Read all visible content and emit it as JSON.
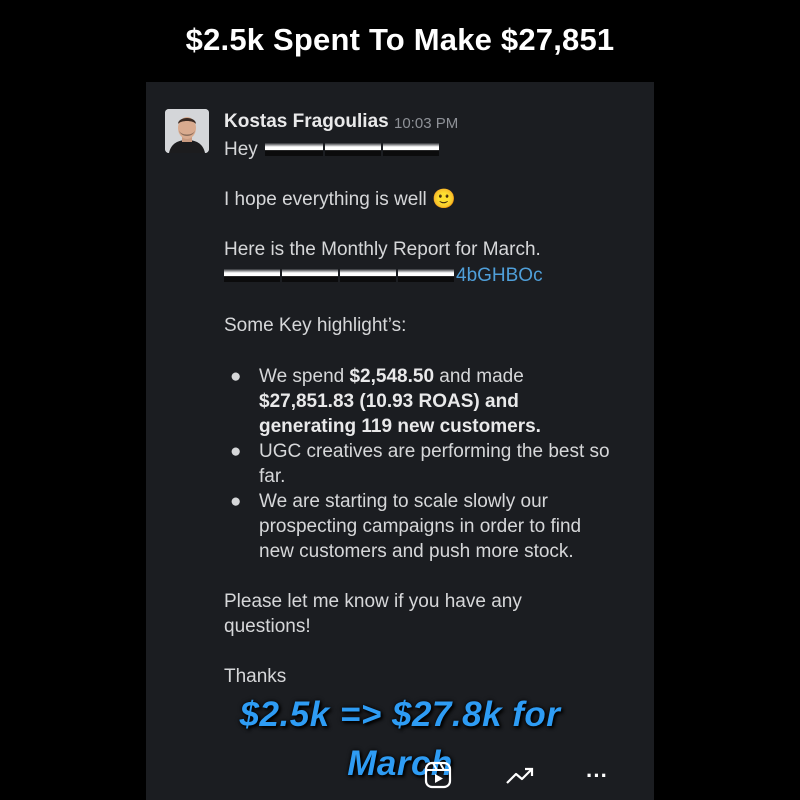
{
  "headline": "$2.5k Spent To Make $27,851",
  "message": {
    "sender": "Kostas Fragoulias",
    "time": "10:03 PM",
    "greeting": "Hey",
    "line1": "I hope everything is well 🙂",
    "line2": "Here is the Monthly Report for March.",
    "link_tail": "4bGHBOc",
    "highlights_title": "Some Key highlight’s:",
    "bullets": [
      {
        "a": "We spend ",
        "b": "$2,548.50",
        "c": " and made",
        "d": "$27,851.83 (10.93 ROAS) and generating 119 new customers."
      },
      {
        "text": "UGC creatives are performing the best so far."
      },
      {
        "text": "We are starting to scale slowly our prospecting campaigns in order to find new customers and push more stock."
      }
    ],
    "closing": "Please let me know if you have any questions!",
    "thanks": "Thanks"
  },
  "overlay": {
    "line1": "$2.5k => $27.8k for",
    "line2": "March"
  },
  "controls": {
    "reel_icon": "reels-icon",
    "trend_icon": "trending-up-icon",
    "more_icon": "more-icon",
    "more_glyph": "···"
  }
}
